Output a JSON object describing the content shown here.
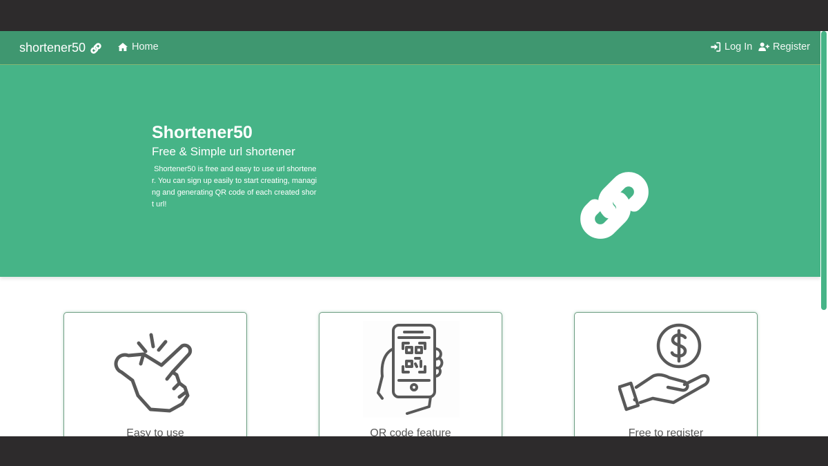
{
  "navbar": {
    "brand": "shortener50",
    "links": {
      "home": "Home",
      "login": "Log In",
      "register": "Register"
    }
  },
  "hero": {
    "title": "Shortener50",
    "subtitle": "Free & Simple url shortener",
    "description": " Shortener50 is free and easy to use url shortener. You can sign up easily to start creating, managing and generating QR code of each created short url!",
    "icon": "link-icon"
  },
  "features": [
    {
      "title": "Easy to use",
      "icon": "snap-fingers-icon"
    },
    {
      "title": "QR code feature",
      "icon": "phone-qr-icon"
    },
    {
      "title": "Free to register",
      "icon": "hand-dollar-icon"
    }
  ],
  "colors": {
    "navbar": "#3f9770",
    "hero": "#46b487",
    "card_border": "#6f9e83",
    "icon_gray": "#595959"
  }
}
